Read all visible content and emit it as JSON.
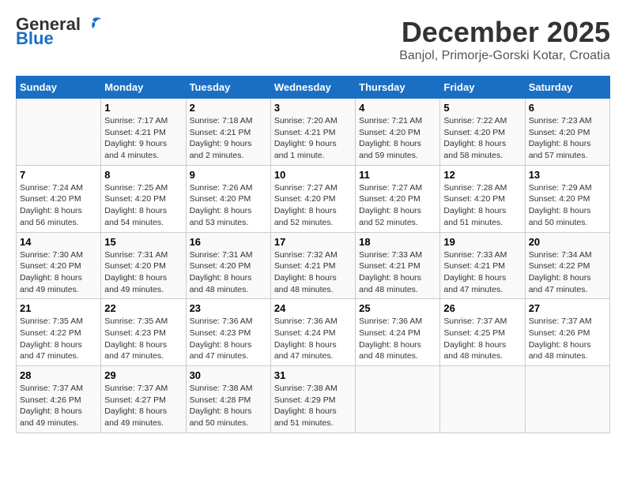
{
  "logo": {
    "general": "General",
    "blue": "Blue"
  },
  "title": "December 2025",
  "subtitle": "Banjol, Primorje-Gorski Kotar, Croatia",
  "days_of_week": [
    "Sunday",
    "Monday",
    "Tuesday",
    "Wednesday",
    "Thursday",
    "Friday",
    "Saturday"
  ],
  "weeks": [
    [
      {
        "day": "",
        "info": ""
      },
      {
        "day": "1",
        "info": "Sunrise: 7:17 AM\nSunset: 4:21 PM\nDaylight: 9 hours\nand 4 minutes."
      },
      {
        "day": "2",
        "info": "Sunrise: 7:18 AM\nSunset: 4:21 PM\nDaylight: 9 hours\nand 2 minutes."
      },
      {
        "day": "3",
        "info": "Sunrise: 7:20 AM\nSunset: 4:21 PM\nDaylight: 9 hours\nand 1 minute."
      },
      {
        "day": "4",
        "info": "Sunrise: 7:21 AM\nSunset: 4:20 PM\nDaylight: 8 hours\nand 59 minutes."
      },
      {
        "day": "5",
        "info": "Sunrise: 7:22 AM\nSunset: 4:20 PM\nDaylight: 8 hours\nand 58 minutes."
      },
      {
        "day": "6",
        "info": "Sunrise: 7:23 AM\nSunset: 4:20 PM\nDaylight: 8 hours\nand 57 minutes."
      }
    ],
    [
      {
        "day": "7",
        "info": "Sunrise: 7:24 AM\nSunset: 4:20 PM\nDaylight: 8 hours\nand 56 minutes."
      },
      {
        "day": "8",
        "info": "Sunrise: 7:25 AM\nSunset: 4:20 PM\nDaylight: 8 hours\nand 54 minutes."
      },
      {
        "day": "9",
        "info": "Sunrise: 7:26 AM\nSunset: 4:20 PM\nDaylight: 8 hours\nand 53 minutes."
      },
      {
        "day": "10",
        "info": "Sunrise: 7:27 AM\nSunset: 4:20 PM\nDaylight: 8 hours\nand 52 minutes."
      },
      {
        "day": "11",
        "info": "Sunrise: 7:27 AM\nSunset: 4:20 PM\nDaylight: 8 hours\nand 52 minutes."
      },
      {
        "day": "12",
        "info": "Sunrise: 7:28 AM\nSunset: 4:20 PM\nDaylight: 8 hours\nand 51 minutes."
      },
      {
        "day": "13",
        "info": "Sunrise: 7:29 AM\nSunset: 4:20 PM\nDaylight: 8 hours\nand 50 minutes."
      }
    ],
    [
      {
        "day": "14",
        "info": "Sunrise: 7:30 AM\nSunset: 4:20 PM\nDaylight: 8 hours\nand 49 minutes."
      },
      {
        "day": "15",
        "info": "Sunrise: 7:31 AM\nSunset: 4:20 PM\nDaylight: 8 hours\nand 49 minutes."
      },
      {
        "day": "16",
        "info": "Sunrise: 7:31 AM\nSunset: 4:20 PM\nDaylight: 8 hours\nand 48 minutes."
      },
      {
        "day": "17",
        "info": "Sunrise: 7:32 AM\nSunset: 4:21 PM\nDaylight: 8 hours\nand 48 minutes."
      },
      {
        "day": "18",
        "info": "Sunrise: 7:33 AM\nSunset: 4:21 PM\nDaylight: 8 hours\nand 48 minutes."
      },
      {
        "day": "19",
        "info": "Sunrise: 7:33 AM\nSunset: 4:21 PM\nDaylight: 8 hours\nand 47 minutes."
      },
      {
        "day": "20",
        "info": "Sunrise: 7:34 AM\nSunset: 4:22 PM\nDaylight: 8 hours\nand 47 minutes."
      }
    ],
    [
      {
        "day": "21",
        "info": "Sunrise: 7:35 AM\nSunset: 4:22 PM\nDaylight: 8 hours\nand 47 minutes."
      },
      {
        "day": "22",
        "info": "Sunrise: 7:35 AM\nSunset: 4:23 PM\nDaylight: 8 hours\nand 47 minutes."
      },
      {
        "day": "23",
        "info": "Sunrise: 7:36 AM\nSunset: 4:23 PM\nDaylight: 8 hours\nand 47 minutes."
      },
      {
        "day": "24",
        "info": "Sunrise: 7:36 AM\nSunset: 4:24 PM\nDaylight: 8 hours\nand 47 minutes."
      },
      {
        "day": "25",
        "info": "Sunrise: 7:36 AM\nSunset: 4:24 PM\nDaylight: 8 hours\nand 48 minutes."
      },
      {
        "day": "26",
        "info": "Sunrise: 7:37 AM\nSunset: 4:25 PM\nDaylight: 8 hours\nand 48 minutes."
      },
      {
        "day": "27",
        "info": "Sunrise: 7:37 AM\nSunset: 4:26 PM\nDaylight: 8 hours\nand 48 minutes."
      }
    ],
    [
      {
        "day": "28",
        "info": "Sunrise: 7:37 AM\nSunset: 4:26 PM\nDaylight: 8 hours\nand 49 minutes."
      },
      {
        "day": "29",
        "info": "Sunrise: 7:37 AM\nSunset: 4:27 PM\nDaylight: 8 hours\nand 49 minutes."
      },
      {
        "day": "30",
        "info": "Sunrise: 7:38 AM\nSunset: 4:28 PM\nDaylight: 8 hours\nand 50 minutes."
      },
      {
        "day": "31",
        "info": "Sunrise: 7:38 AM\nSunset: 4:29 PM\nDaylight: 8 hours\nand 51 minutes."
      },
      {
        "day": "",
        "info": ""
      },
      {
        "day": "",
        "info": ""
      },
      {
        "day": "",
        "info": ""
      }
    ]
  ]
}
